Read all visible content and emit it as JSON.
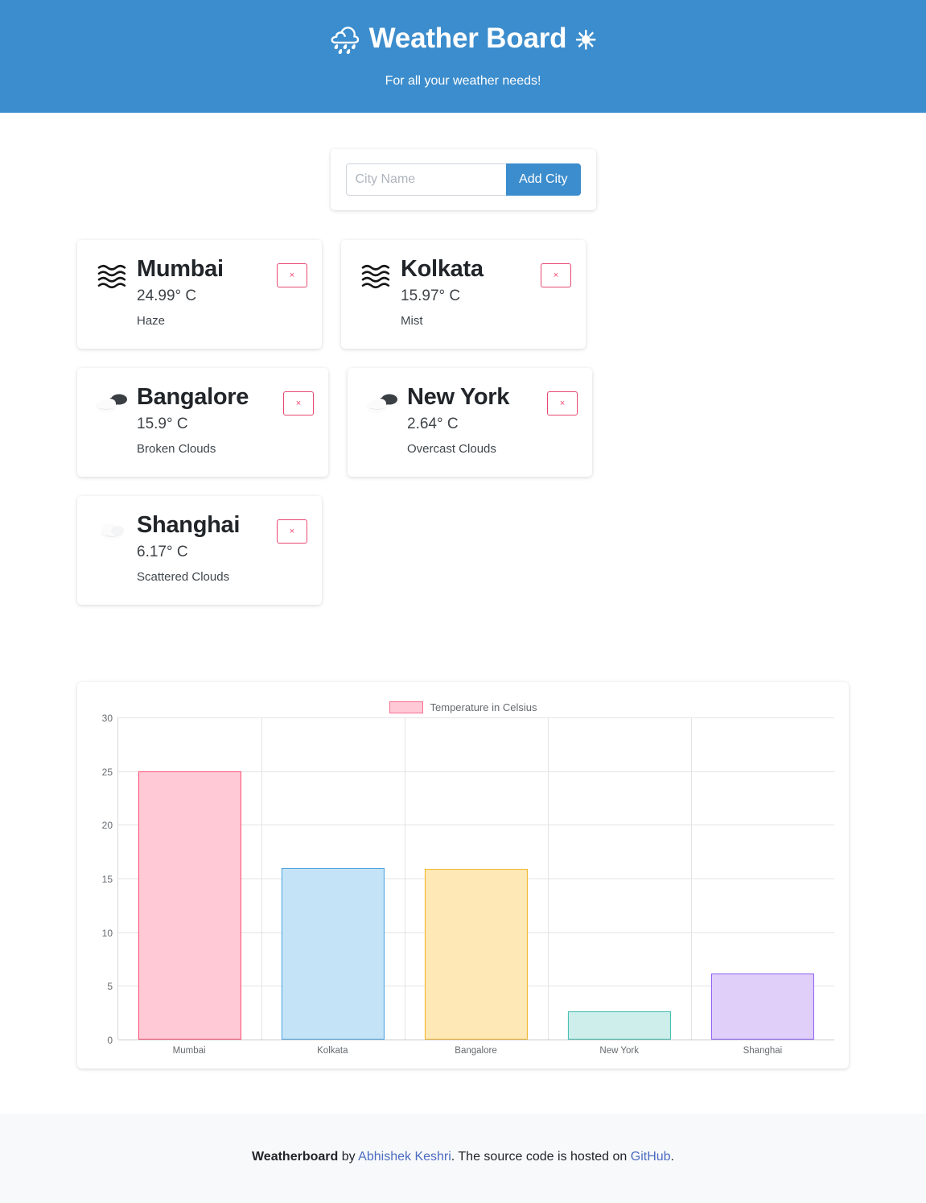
{
  "header": {
    "title": "Weather Board",
    "icon_left": "rain-cloud-emoji",
    "icon_left_glyph": "🌧",
    "icon_right": "sun-emoji",
    "icon_right_glyph": "☀",
    "tagline": "For all your weather needs!",
    "background_color": "#3c8dcd"
  },
  "search": {
    "placeholder": "City Name",
    "value": "",
    "button_label": "Add City",
    "button_color": "#3c8dcd"
  },
  "cities": [
    {
      "name": "Mumbai",
      "temperature": "24.99° C",
      "condition": "Haze",
      "icon": "haze-icon",
      "delete_label": "×"
    },
    {
      "name": "Kolkata",
      "temperature": "15.97° C",
      "condition": "Mist",
      "icon": "mist-icon",
      "delete_label": "×"
    },
    {
      "name": "Bangalore",
      "temperature": "15.9° C",
      "condition": "Broken Clouds",
      "icon": "broken-clouds-icon",
      "delete_label": "×"
    },
    {
      "name": "New York",
      "temperature": "2.64° C",
      "condition": "Overcast Clouds",
      "icon": "overcast-clouds-icon",
      "delete_label": "×"
    },
    {
      "name": "Shanghai",
      "temperature": "6.17° C",
      "condition": "Scattered Clouds",
      "icon": "scattered-clouds-icon",
      "delete_label": "×"
    }
  ],
  "chart_data": {
    "type": "bar",
    "title": "",
    "xlabel": "",
    "ylabel": "",
    "ylim": [
      0,
      30
    ],
    "yticks": [
      0,
      5,
      10,
      15,
      20,
      25,
      30
    ],
    "grid": true,
    "legend_position": "top",
    "legend": [
      "Temperature in Celsius"
    ],
    "categories": [
      "Mumbai",
      "Kolkata",
      "Bangalore",
      "New York",
      "Shanghai"
    ],
    "values": [
      24.99,
      15.97,
      15.9,
      2.64,
      6.17
    ],
    "series": [
      {
        "name": "Temperature in Celsius",
        "values": [
          24.99,
          15.97,
          15.9,
          2.64,
          6.17
        ]
      }
    ],
    "bar_fill_colors": [
      "#ffc9d6",
      "#c5e3f7",
      "#fde8b6",
      "#cdeeea",
      "#e0d0f9"
    ],
    "bar_border_colors": [
      "#fb4b72",
      "#4aa3df",
      "#f0b429",
      "#3fbcb0",
      "#8b5cf6"
    ]
  },
  "footer": {
    "brand": "Weatherboard",
    "by": " by ",
    "author": "Abhishek Keshri",
    "middle": ". The source code is hosted on ",
    "repo": "GitHub",
    "end": "."
  }
}
